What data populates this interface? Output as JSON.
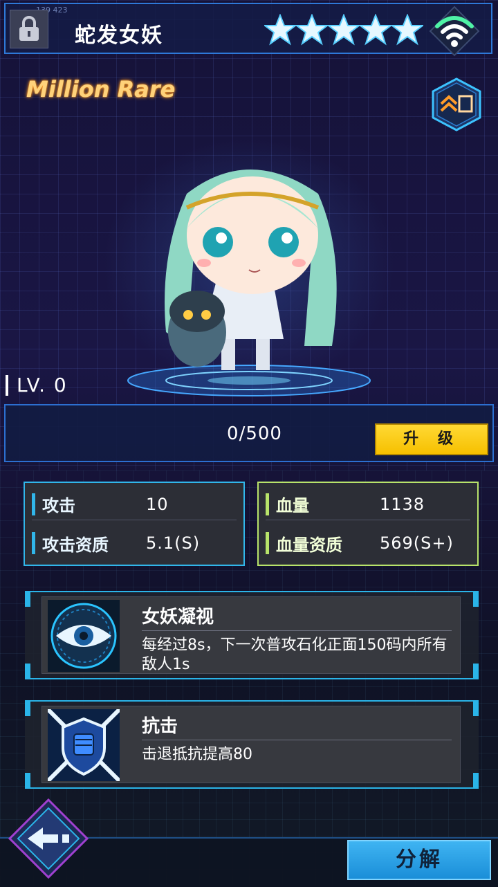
{
  "header": {
    "tiny_id": "139 423",
    "hero_name": "蛇发女妖",
    "star_count": 5,
    "max_stars": 5
  },
  "rarity": "Million Rare",
  "level": {
    "label": "LV. 0",
    "exp_text": "0/500",
    "upgrade_label": "升 级"
  },
  "stats_attack": {
    "attack_label": "攻击",
    "attack_value": "10",
    "attack_quality_label": "攻击资质",
    "attack_quality_value": "5.1(S)"
  },
  "stats_hp": {
    "hp_label": "血量",
    "hp_value": "1138",
    "hp_quality_label": "血量资质",
    "hp_quality_value": "569(S+)"
  },
  "skills": [
    {
      "name": "女妖凝视",
      "desc": "每经过8s，下一次普攻石化正面150码内所有敌人1s",
      "icon": "eye-icon"
    },
    {
      "name": "抗击",
      "desc": "击退抵抗提高80",
      "icon": "fist-shield-icon"
    }
  ],
  "bottom": {
    "decompose_label": "分解",
    "back_icon": "arrow-left-icon"
  },
  "colors": {
    "accent_blue": "#31b6ea",
    "accent_green": "#b8e36a",
    "upgrade_yellow": "#f6c000",
    "rarity_gold": "#ffd27a"
  }
}
